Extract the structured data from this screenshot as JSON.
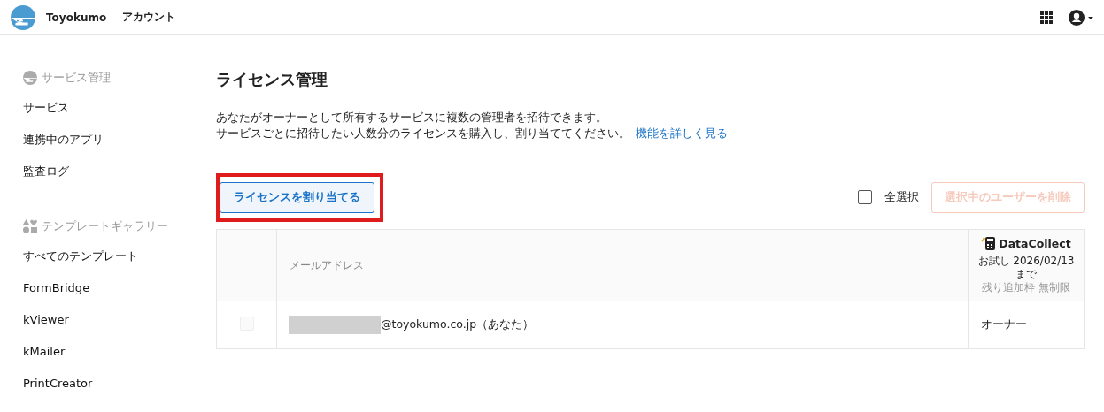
{
  "header": {
    "brand": "Toyokumo",
    "title": "アカウント"
  },
  "sidebar": {
    "sections": [
      {
        "heading": "サービス管理",
        "items": [
          {
            "label": "サービス",
            "selected": false
          },
          {
            "label": "連携中のアプリ",
            "selected": false
          },
          {
            "label": "監査ログ",
            "selected": false
          }
        ]
      },
      {
        "heading": "テンプレートギャラリー",
        "items": [
          {
            "label": "すべてのテンプレート",
            "selected": false
          },
          {
            "label": "FormBridge",
            "selected": false
          },
          {
            "label": "kViewer",
            "selected": false
          },
          {
            "label": "kMailer",
            "selected": false
          },
          {
            "label": "PrintCreator",
            "selected": false
          }
        ]
      }
    ]
  },
  "main": {
    "title": "ライセンス管理",
    "description": [
      "あなたがオーナーとして所有するサービスに複数の管理者を招待できます。",
      "サービスごとに招待したい人数分のライセンスを購入し、割り当ててください。"
    ],
    "link": "機能を詳しく見る",
    "assign_button": {
      "label": "ライセンスを割り当てる",
      "highlighted": true
    },
    "select_all": {
      "label": "全選択",
      "checked": false
    },
    "delete_button": {
      "label": "選択中のユーザーを削除",
      "disabled": true
    },
    "table": {
      "columns": [
        {
          "label": "メールアドレス"
        },
        {
          "service": "DataCollect",
          "trial": "お試し 2026/02/13",
          "until": "まで",
          "remaining_label": "残り追加枠",
          "remaining_value": "無制限"
        }
      ],
      "rows": [
        {
          "checked": false,
          "disabled": true,
          "redacted": true,
          "email": "@toyokumo.co.jp（あなた）",
          "role": "オーナー"
        }
      ]
    }
  }
}
